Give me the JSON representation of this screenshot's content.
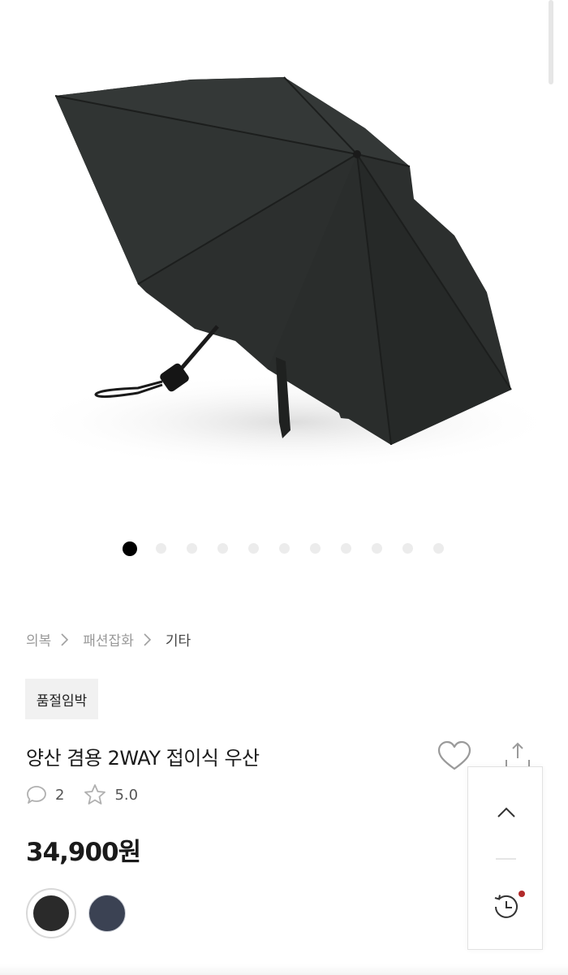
{
  "product_image": {
    "icon": "umbrella-image",
    "color": "#2b2e2d"
  },
  "carousel": {
    "count": 11,
    "active_index": 0
  },
  "breadcrumb": {
    "items": [
      "의복",
      "패션잡화",
      "기타"
    ]
  },
  "badge": {
    "label": "품절임박"
  },
  "product": {
    "title": "양산 겸용 2WAY 접이식 우산",
    "review_count": "2",
    "rating": "5.0",
    "price": "34,900원"
  },
  "swatches": [
    {
      "name": "black",
      "color": "#2a2a2a",
      "selected": true
    },
    {
      "name": "navy",
      "color": "#3b4253",
      "selected": false
    }
  ],
  "floating_menu": {
    "icons": [
      "chevron-up-icon",
      "history-icon"
    ],
    "notification_color": "#b22a2a"
  }
}
